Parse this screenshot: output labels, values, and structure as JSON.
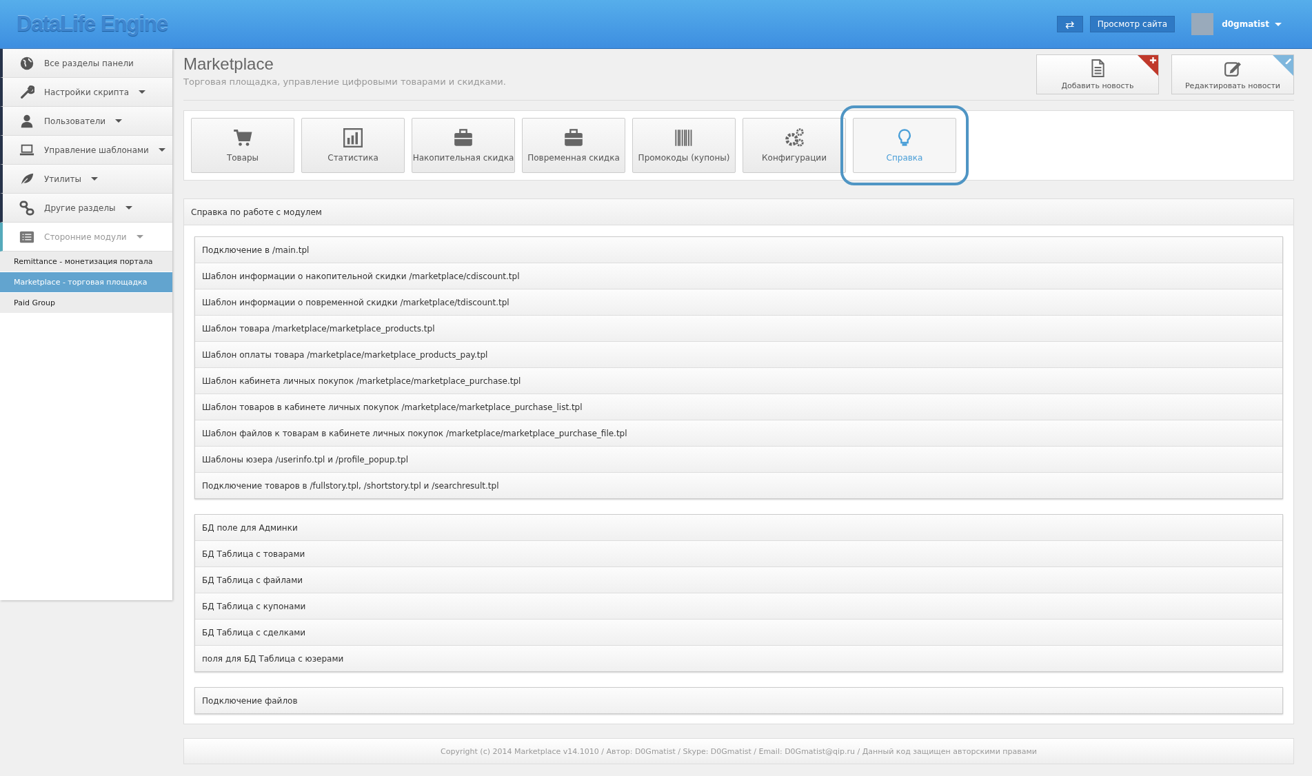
{
  "header": {
    "logo": "DataLife Engine",
    "swap_icon": "⇄",
    "view_site": "Просмотр сайта",
    "user": "d0gmatist"
  },
  "sidebar": {
    "items": [
      {
        "label": "Все разделы панели",
        "dropdown": false,
        "selected": false
      },
      {
        "label": "Настройки скрипта",
        "dropdown": true,
        "selected": false
      },
      {
        "label": "Пользователи",
        "dropdown": true,
        "selected": false
      },
      {
        "label": "Управление шаблонами",
        "dropdown": true,
        "selected": false
      },
      {
        "label": "Утилиты",
        "dropdown": true,
        "selected": false
      },
      {
        "label": "Другие разделы",
        "dropdown": true,
        "selected": false
      },
      {
        "label": "Сторонние модули",
        "dropdown": true,
        "selected": true
      }
    ],
    "subitems": [
      {
        "label": "Remittance - монетизация портала",
        "selected": false
      },
      {
        "label": "Marketplace - торговая площадка",
        "selected": true
      },
      {
        "label": "Paid Group",
        "selected": false
      }
    ]
  },
  "page": {
    "title": "Marketplace",
    "subtitle": "Торговая площадка, управление цифровыми товарами и скидками.",
    "actions": [
      {
        "label": "Добавить новость",
        "kind": "add"
      },
      {
        "label": "Редактировать новости",
        "kind": "edit"
      }
    ]
  },
  "tabs": [
    {
      "label": "Товары",
      "selected": false
    },
    {
      "label": "Статистика",
      "selected": false
    },
    {
      "label": "Накопительная скидка",
      "selected": false
    },
    {
      "label": "Повременная скидка",
      "selected": false
    },
    {
      "label": "Промокоды (купоны)",
      "selected": false
    },
    {
      "label": "Конфигурации",
      "selected": false
    },
    {
      "label": "Справка",
      "selected": true
    }
  ],
  "help": {
    "title": "Справка по работе с модулем",
    "groups": [
      [
        "Подключение в /main.tpl",
        "Шаблон информации о накопительной скидки /marketplace/cdiscount.tpl",
        "Шаблон информации о повременной скидки /marketplace/tdiscount.tpl",
        "Шаблон товара /marketplace/marketplace_products.tpl",
        "Шаблон оплаты товара /marketplace/marketplace_products_pay.tpl",
        "Шаблон кабинета личных покупок /marketplace/marketplace_purchase.tpl",
        "Шаблон товаров в кабинете личных покупок /marketplace/marketplace_purchase_list.tpl",
        "Шаблон файлов к товарам в кабинете личных покупок /marketplace/marketplace_purchase_file.tpl",
        "Шаблоны юзера /userinfo.tpl и /profile_popup.tpl",
        "Подключение товаров в /fullstory.tpl, /shortstory.tpl и /searchresult.tpl"
      ],
      [
        "БД поле для Админки",
        "БД Таблица с товарами",
        "БД Таблица с файлами",
        "БД Таблица с купонами",
        "БД Таблица с сделками",
        "поля для БД Таблица с юзерами"
      ],
      [
        "Подключение файлов"
      ]
    ]
  },
  "footer": "Copyright (c) 2014 Marketplace v14.1010 / Автор: D0Gmatist / Skype: D0Gmatist / Email: D0Gmatist@qip.ru / Данный код защищен авторскими правами"
}
